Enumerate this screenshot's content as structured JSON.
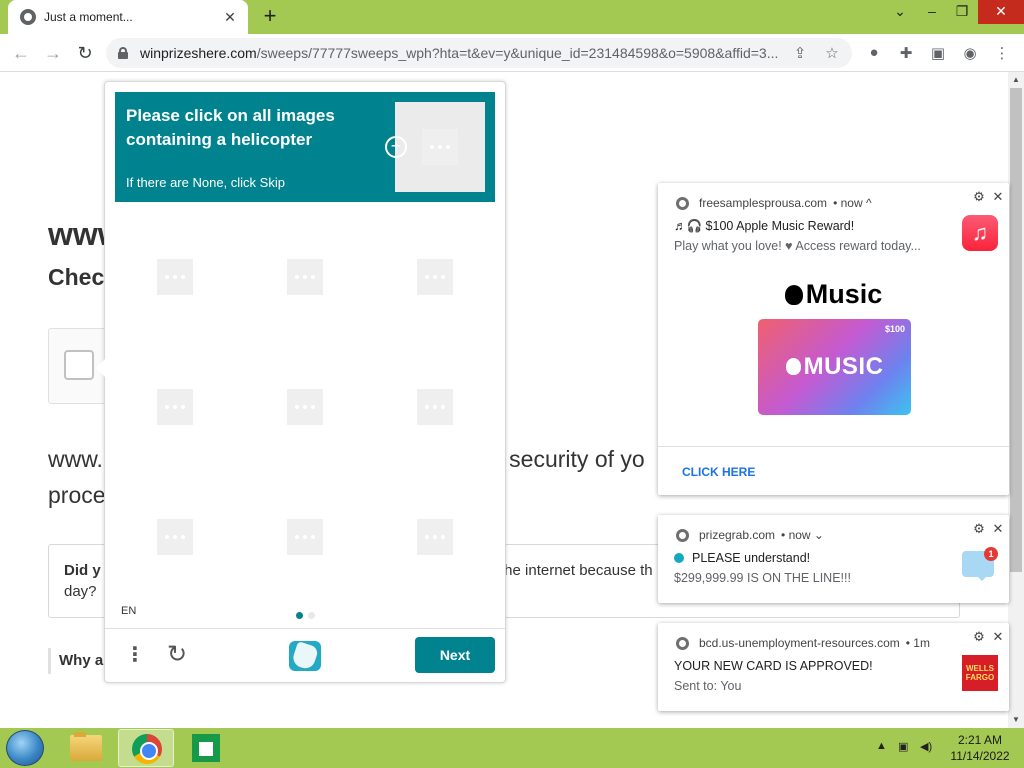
{
  "browser": {
    "tab_title": "Just a moment...",
    "new_tab_label": "+",
    "url_host": "winprizeshere.com",
    "url_path": "/sweeps/77777sweeps_wph?hta=t&ev=y&unique_id=231484598&o=5908&affid=3..."
  },
  "page": {
    "title": "www",
    "subtitle": "Check",
    "paragraph_line1": "www.",
    "paragraph_line1_right": "e security of yo",
    "paragraph_line2": "proce",
    "box_line1": "Did y",
    "box_line2": "day?",
    "box_right": "the internet because th",
    "why_label": "Why a"
  },
  "captcha": {
    "prompt": "Please click on all images containing a helicopter",
    "skip_hint": "If there are None, click Skip",
    "language": "EN",
    "next_label": "Next",
    "accent": "#00838f"
  },
  "notifications": [
    {
      "source": "freesamplesprousa.com",
      "time": "• now ^",
      "title": "♬🎧 $100 Apple Music Reward!",
      "body": "Play what you love! ♥ Access reward today...",
      "hero_text": "Music",
      "card_price": "$100",
      "card_label": "MUSIC",
      "action": "CLICK HERE"
    },
    {
      "source": "prizegrab.com",
      "time": "• now ⌄",
      "title": "PLEASE understand!",
      "body": "$299,999.99 IS ON THE LINE!!!",
      "badge": "1"
    },
    {
      "source": "bcd.us-unemployment-resources.com",
      "time": "• 1m",
      "title": "YOUR NEW CARD IS APPROVED!",
      "body": "Sent to: You",
      "logo_text": "WELLS FARGO"
    }
  ],
  "taskbar": {
    "time": "2:21 AM",
    "date": "11/14/2022",
    "color": "#a3c952"
  }
}
